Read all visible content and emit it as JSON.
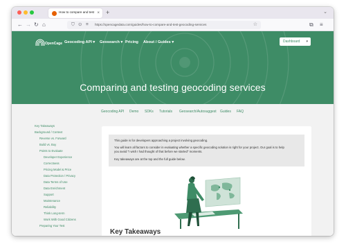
{
  "browser": {
    "tab_title": "How to compare and test geoc",
    "tab_close": "×",
    "new_tab": "+",
    "tabs_menu": "⌄",
    "url": "https://opencagedata.com/guides/how-to-compare-and-test-geocoding-services",
    "icons": [
      "firefox-icon",
      "back-icon",
      "forward-icon",
      "reload-icon",
      "home-icon",
      "shield-icon",
      "lock-icon",
      "star-icon",
      "extensions-icon",
      "menu-icon"
    ]
  },
  "site": {
    "logo_text": "OpenCage",
    "nav": [
      {
        "label": "Geocoding API ▾"
      },
      {
        "label": "Geosearch ▾"
      },
      {
        "label": "Pricing"
      },
      {
        "label": "About / Guides ▾"
      }
    ],
    "dashboard_label": "Dashboard",
    "dashboard_caret": "▾",
    "page_title": "Comparing and testing geocoding services",
    "brand_color": "#3e8c66"
  },
  "subnav": [
    "Geocoding API",
    "Demo",
    "SDKs",
    "Tutorials",
    "Geosearch/Autosuggest",
    "Guides",
    "FAQ"
  ],
  "toc": [
    {
      "label": "Key Takeaways",
      "level": 0
    },
    {
      "label": "Background / Context",
      "level": 0
    },
    {
      "label": "Reverse vs. Forward",
      "level": 1
    },
    {
      "label": "Build vs. Buy",
      "level": 1
    },
    {
      "label": "Points to Evaluate",
      "level": 1
    },
    {
      "label": "Developer Experience",
      "level": 2
    },
    {
      "label": "Correctness",
      "level": 2
    },
    {
      "label": "Pricing Model & Price",
      "level": 2
    },
    {
      "label": "Data Protection / Privacy",
      "level": 2
    },
    {
      "label": "Data Terms of Use",
      "level": 2
    },
    {
      "label": "Data Enrichment",
      "level": 2
    },
    {
      "label": "Support",
      "level": 2
    },
    {
      "label": "Maintenance",
      "level": 2
    },
    {
      "label": "Reliability",
      "level": 2
    },
    {
      "label": "Think Long-term",
      "level": 2
    },
    {
      "label": "Work With Good Citizens",
      "level": 2
    },
    {
      "label": "Preparing Your Test",
      "level": 1
    }
  ],
  "intro": {
    "line1": "This guide is for developers approaching a project involving geocoding.",
    "line2": "You will learn all factors to consider in evaluating whether a specific geocoding solution is right for your project. Our goal is to help",
    "line3": "you avoid \"I wish I had thought of that before we started\" moments.",
    "line4": "Key takeaways are at the top and the full guide below."
  },
  "key_heading": "Key Takeaways"
}
